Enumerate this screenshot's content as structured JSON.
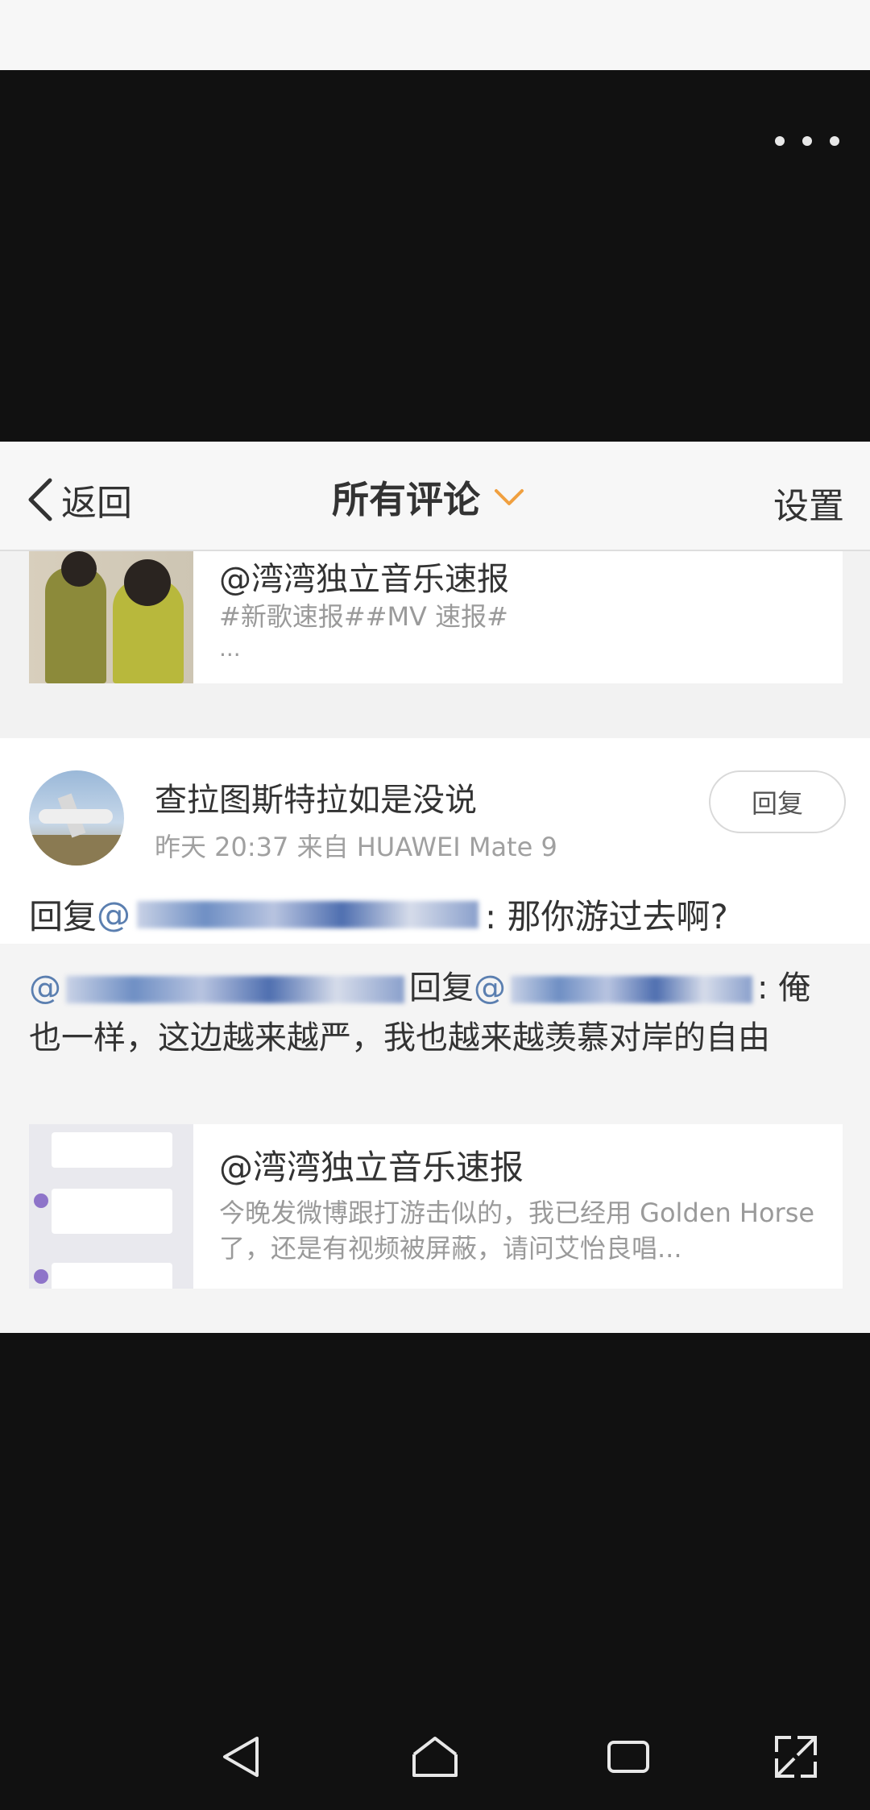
{
  "nav": {
    "back_label": "返回",
    "title": "所有评论",
    "settings_label": "设置"
  },
  "card_top": {
    "title": "@湾湾独立音乐速报",
    "tags": "#新歌速报##MV 速报#",
    "ellipsis": "..."
  },
  "comment": {
    "username": "查拉图斯特拉如是没说",
    "meta": "昨天 20:37  来自 HUAWEI Mate 9",
    "reply_button": "回复",
    "reply_prefix": "回复",
    "mention_at": "@",
    "reply_text": ": 那你游过去啊?"
  },
  "quoted": {
    "mention_at": "@",
    "reply_word": "回复",
    "mention_at_2": "@",
    "text_part1": ": 俺也一样，这边越来越严，我也越来越羡慕对岸的自由"
  },
  "card_bottom": {
    "title": "@湾湾独立音乐速报",
    "excerpt": "今晚发微博跟打游击似的，我已经用 Golden Horse 了，还是有视频被屏蔽，请问艾怡良唱..."
  },
  "icons": {
    "more": "more-dots-icon",
    "back": "chevron-left-icon",
    "dropdown": "chevron-down-icon",
    "system_back": "triangle-back-icon",
    "system_home": "home-icon",
    "system_recent": "recent-apps-icon",
    "system_expand": "expand-icon"
  },
  "colors": {
    "accent_orange": "#f0a040",
    "link_blue": "#5b7fb0"
  }
}
